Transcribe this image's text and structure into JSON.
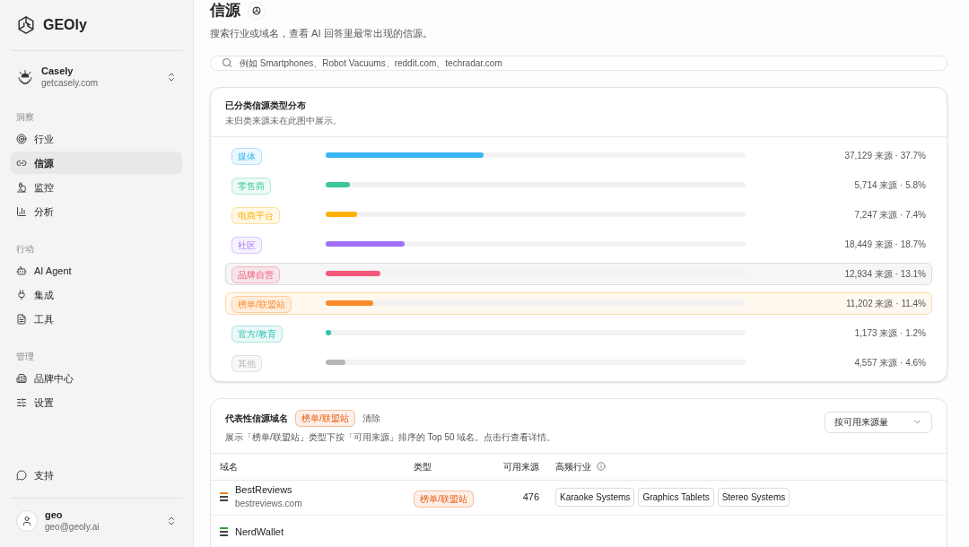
{
  "sidebar": {
    "brand": "GEOly",
    "workspace": {
      "name": "Casely",
      "domain": "getcasely.com"
    },
    "sections": [
      {
        "title": "洞察",
        "items": [
          {
            "label": "行业",
            "selected": false
          },
          {
            "label": "信源",
            "selected": true
          },
          {
            "label": "监控",
            "selected": false
          },
          {
            "label": "分析",
            "selected": false
          }
        ]
      },
      {
        "title": "行动",
        "items": [
          {
            "label": "AI Agent",
            "selected": false
          },
          {
            "label": "集成",
            "selected": false
          },
          {
            "label": "工具",
            "selected": false
          }
        ]
      },
      {
        "title": "管理",
        "items": [
          {
            "label": "品牌中心",
            "selected": false
          },
          {
            "label": "设置",
            "selected": false
          }
        ]
      }
    ],
    "support": "支持",
    "user": {
      "name": "geo",
      "email": "geo@geoly.ai"
    }
  },
  "header": {
    "title": "信源",
    "subtitle": "搜索行业或域名，查看 AI 回答里最常出现的信源。"
  },
  "search": {
    "placeholder": "例如 Smartphones、Robot Vacuums、reddit.com、techradar.com"
  },
  "distribution": {
    "title": "已分类信源类型分布",
    "subtitle": "未归类来源未在此图中展示。",
    "rows": [
      {
        "label": "媒体",
        "color": "#38b6f5",
        "level": 0.377,
        "reading": "37,129 来源 · 37.7%",
        "selected": false,
        "highlighted": false
      },
      {
        "label": "零售商",
        "color": "#3cc894",
        "level": 0.058,
        "reading": "5,714 来源 · 5.8%",
        "selected": false,
        "highlighted": false
      },
      {
        "label": "电商平台",
        "color": "#ffb000",
        "level": 0.074,
        "reading": "7,247 来源 · 7.4%",
        "selected": false,
        "highlighted": false
      },
      {
        "label": "社区",
        "color": "#a070f8",
        "level": 0.187,
        "reading": "18,449 来源 · 18.7%",
        "selected": false,
        "highlighted": false
      },
      {
        "label": "品牌自营",
        "color": "#f5577a",
        "level": 0.131,
        "reading": "12,934 来源 · 13.1%",
        "selected": false,
        "highlighted": true
      },
      {
        "label": "榜单/联盟站",
        "color": "#fb8a2a",
        "level": 0.114,
        "reading": "11,202 来源 · 11.4%",
        "selected": true,
        "highlighted": false
      },
      {
        "label": "官方/教育",
        "color": "#2cc4b0",
        "level": 0.012,
        "reading": "1,173 来源 · 1.2%",
        "selected": false,
        "highlighted": false
      },
      {
        "label": "其他",
        "color": "#b5b5b5",
        "level": 0.046,
        "reading": "4,557 来源 · 4.6%",
        "selected": false,
        "highlighted": false
      }
    ]
  },
  "domains": {
    "title": "代表性信源域名",
    "filter": "榜单/联盟站",
    "clear": "清除",
    "subtitle": "展示「榜单/联盟站」类型下按「可用来源」排序的 Top 50 域名。点击行查看详情。",
    "sort": "按可用来源量",
    "columns": [
      "域名",
      "类型",
      "可用来源",
      "高频行业"
    ],
    "rows": [
      {
        "name": "BestReviews",
        "domain": "bestreviews.com",
        "type": "榜单/联盟站",
        "count": "476",
        "industries": [
          "Karaoke Systems",
          "Graphics Tablets",
          "Stereo Systems"
        ]
      },
      {
        "name": "NerdWallet"
      }
    ]
  }
}
